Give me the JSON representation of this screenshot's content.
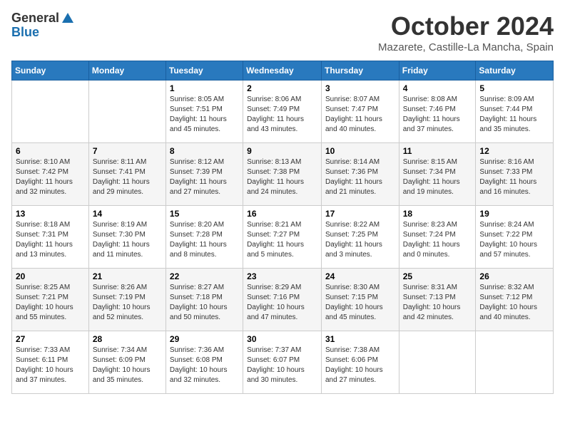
{
  "logo": {
    "general": "General",
    "blue": "Blue"
  },
  "title": "October 2024",
  "location": "Mazarete, Castille-La Mancha, Spain",
  "days_of_week": [
    "Sunday",
    "Monday",
    "Tuesday",
    "Wednesday",
    "Thursday",
    "Friday",
    "Saturday"
  ],
  "weeks": [
    [
      {
        "day": "",
        "info": ""
      },
      {
        "day": "",
        "info": ""
      },
      {
        "day": "1",
        "info": "Sunrise: 8:05 AM\nSunset: 7:51 PM\nDaylight: 11 hours and 45 minutes."
      },
      {
        "day": "2",
        "info": "Sunrise: 8:06 AM\nSunset: 7:49 PM\nDaylight: 11 hours and 43 minutes."
      },
      {
        "day": "3",
        "info": "Sunrise: 8:07 AM\nSunset: 7:47 PM\nDaylight: 11 hours and 40 minutes."
      },
      {
        "day": "4",
        "info": "Sunrise: 8:08 AM\nSunset: 7:46 PM\nDaylight: 11 hours and 37 minutes."
      },
      {
        "day": "5",
        "info": "Sunrise: 8:09 AM\nSunset: 7:44 PM\nDaylight: 11 hours and 35 minutes."
      }
    ],
    [
      {
        "day": "6",
        "info": "Sunrise: 8:10 AM\nSunset: 7:42 PM\nDaylight: 11 hours and 32 minutes."
      },
      {
        "day": "7",
        "info": "Sunrise: 8:11 AM\nSunset: 7:41 PM\nDaylight: 11 hours and 29 minutes."
      },
      {
        "day": "8",
        "info": "Sunrise: 8:12 AM\nSunset: 7:39 PM\nDaylight: 11 hours and 27 minutes."
      },
      {
        "day": "9",
        "info": "Sunrise: 8:13 AM\nSunset: 7:38 PM\nDaylight: 11 hours and 24 minutes."
      },
      {
        "day": "10",
        "info": "Sunrise: 8:14 AM\nSunset: 7:36 PM\nDaylight: 11 hours and 21 minutes."
      },
      {
        "day": "11",
        "info": "Sunrise: 8:15 AM\nSunset: 7:34 PM\nDaylight: 11 hours and 19 minutes."
      },
      {
        "day": "12",
        "info": "Sunrise: 8:16 AM\nSunset: 7:33 PM\nDaylight: 11 hours and 16 minutes."
      }
    ],
    [
      {
        "day": "13",
        "info": "Sunrise: 8:18 AM\nSunset: 7:31 PM\nDaylight: 11 hours and 13 minutes."
      },
      {
        "day": "14",
        "info": "Sunrise: 8:19 AM\nSunset: 7:30 PM\nDaylight: 11 hours and 11 minutes."
      },
      {
        "day": "15",
        "info": "Sunrise: 8:20 AM\nSunset: 7:28 PM\nDaylight: 11 hours and 8 minutes."
      },
      {
        "day": "16",
        "info": "Sunrise: 8:21 AM\nSunset: 7:27 PM\nDaylight: 11 hours and 5 minutes."
      },
      {
        "day": "17",
        "info": "Sunrise: 8:22 AM\nSunset: 7:25 PM\nDaylight: 11 hours and 3 minutes."
      },
      {
        "day": "18",
        "info": "Sunrise: 8:23 AM\nSunset: 7:24 PM\nDaylight: 11 hours and 0 minutes."
      },
      {
        "day": "19",
        "info": "Sunrise: 8:24 AM\nSunset: 7:22 PM\nDaylight: 10 hours and 57 minutes."
      }
    ],
    [
      {
        "day": "20",
        "info": "Sunrise: 8:25 AM\nSunset: 7:21 PM\nDaylight: 10 hours and 55 minutes."
      },
      {
        "day": "21",
        "info": "Sunrise: 8:26 AM\nSunset: 7:19 PM\nDaylight: 10 hours and 52 minutes."
      },
      {
        "day": "22",
        "info": "Sunrise: 8:27 AM\nSunset: 7:18 PM\nDaylight: 10 hours and 50 minutes."
      },
      {
        "day": "23",
        "info": "Sunrise: 8:29 AM\nSunset: 7:16 PM\nDaylight: 10 hours and 47 minutes."
      },
      {
        "day": "24",
        "info": "Sunrise: 8:30 AM\nSunset: 7:15 PM\nDaylight: 10 hours and 45 minutes."
      },
      {
        "day": "25",
        "info": "Sunrise: 8:31 AM\nSunset: 7:13 PM\nDaylight: 10 hours and 42 minutes."
      },
      {
        "day": "26",
        "info": "Sunrise: 8:32 AM\nSunset: 7:12 PM\nDaylight: 10 hours and 40 minutes."
      }
    ],
    [
      {
        "day": "27",
        "info": "Sunrise: 7:33 AM\nSunset: 6:11 PM\nDaylight: 10 hours and 37 minutes."
      },
      {
        "day": "28",
        "info": "Sunrise: 7:34 AM\nSunset: 6:09 PM\nDaylight: 10 hours and 35 minutes."
      },
      {
        "day": "29",
        "info": "Sunrise: 7:36 AM\nSunset: 6:08 PM\nDaylight: 10 hours and 32 minutes."
      },
      {
        "day": "30",
        "info": "Sunrise: 7:37 AM\nSunset: 6:07 PM\nDaylight: 10 hours and 30 minutes."
      },
      {
        "day": "31",
        "info": "Sunrise: 7:38 AM\nSunset: 6:06 PM\nDaylight: 10 hours and 27 minutes."
      },
      {
        "day": "",
        "info": ""
      },
      {
        "day": "",
        "info": ""
      }
    ]
  ]
}
